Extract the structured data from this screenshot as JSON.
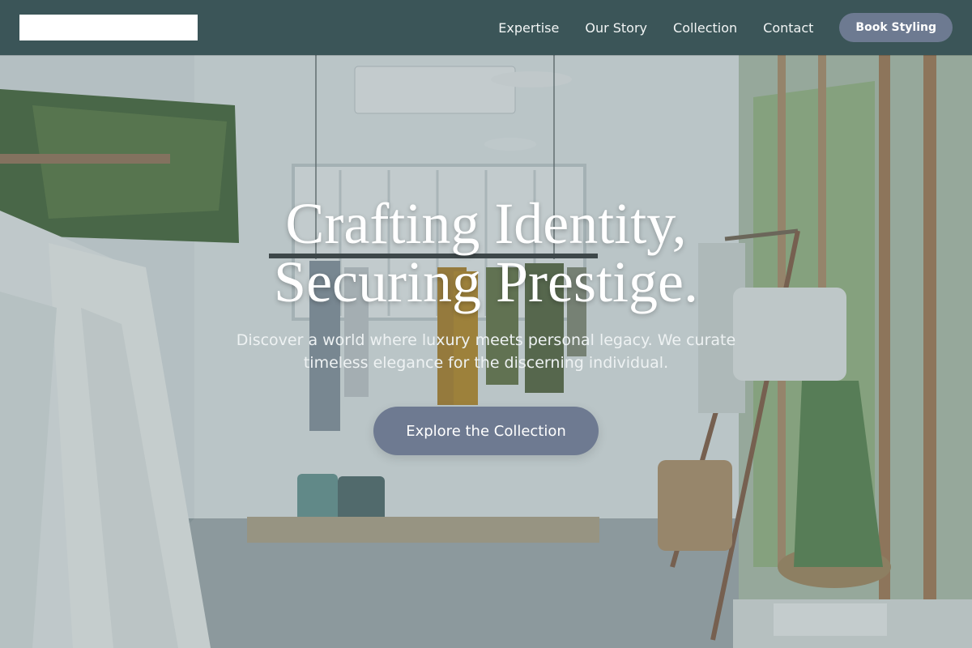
{
  "header": {
    "nav": [
      "Expertise",
      "Our Story",
      "Collection",
      "Contact"
    ],
    "cta_label": "Book Styling"
  },
  "hero": {
    "title_line1": "Crafting Identity,",
    "title_line2": "Securing Prestige.",
    "subtitle": "Discover a world where luxury meets personal legacy. We curate timeless elegance for the discerning individual.",
    "cta_label": "Explore the Collection"
  },
  "colors": {
    "header_bg": "#3b5558",
    "button_bg": "#6d7a91",
    "logo_bg": "#ffffff"
  }
}
